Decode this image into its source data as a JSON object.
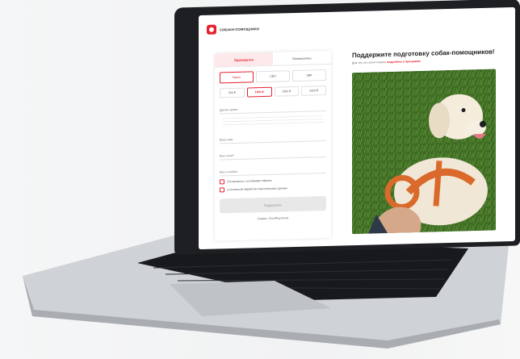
{
  "brand": "СОБАКИ-ПОМОЩНИКИ",
  "form": {
    "tabs": [
      "Однократно",
      "Ежемесячно"
    ],
    "payment_methods": [
      "Карты",
      "СБП",
      "SBP"
    ],
    "amounts": [
      "500 ₽",
      "1000 ₽",
      "1500 ₽",
      "3000 ₽"
    ],
    "amount_label": "Другая сумма",
    "name_placeholder": "Ваше имя",
    "email_placeholder": "Ваш email*",
    "phone_placeholder": "Ваш телефон",
    "consent_1": "Соглашаюсь с условиями оферты",
    "consent_2": "и политикой обработки персональных данных",
    "submit_label": "Поддержать",
    "secure_label": "Сервис: CloudPayments"
  },
  "hero": {
    "headline": "Поддержите подготовку собак-помощников!",
    "subtext_pre": "Для тех, кто хочет помочь",
    "subtext_link": "подробнее о программе"
  },
  "colors": {
    "brand_red": "#e4222f",
    "screen_bezel": "#1d1f22",
    "laptop_body": "#c9ccd0"
  }
}
